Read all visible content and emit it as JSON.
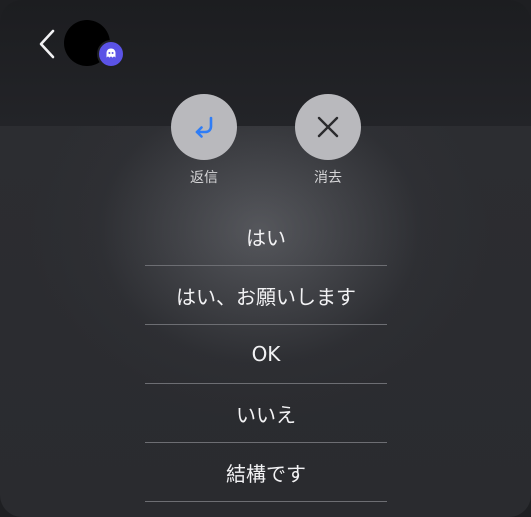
{
  "header": {
    "back_icon": "chevron-left-icon",
    "avatar_icon": "avatar",
    "app_badge_icon": "app-badge-icon",
    "badge_color": "#5b53e6"
  },
  "actions": {
    "reply": {
      "label": "返信",
      "icon": "reply-arrow-icon",
      "icon_color": "#2f7df6"
    },
    "dismiss": {
      "label": "消去",
      "icon": "close-x-icon"
    }
  },
  "quick_replies": [
    "はい",
    "はい、お願いします",
    "OK",
    "いいえ",
    "結構です"
  ]
}
